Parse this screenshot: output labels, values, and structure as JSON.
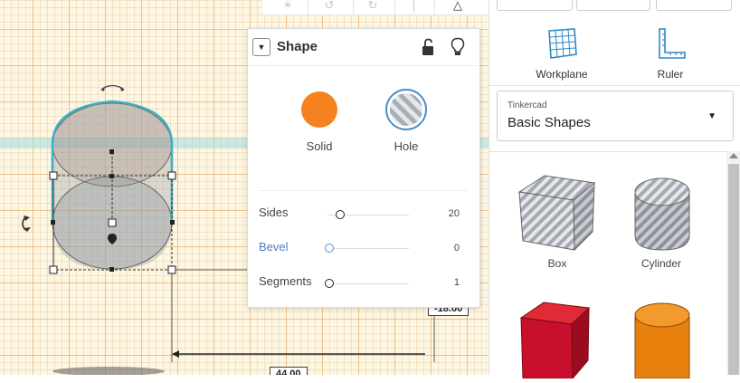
{
  "app": {
    "name": "Tinkercad"
  },
  "shape_panel": {
    "title": "Shape",
    "solid_label": "Solid",
    "hole_label": "Hole",
    "solid_color": "#f5821f",
    "hole_accent": "#4a90c8",
    "properties": [
      {
        "label": "Sides",
        "value": "20",
        "slider_fraction": 0.15
      },
      {
        "label": "Bevel",
        "value": "0",
        "slider_fraction": 0.0
      },
      {
        "label": "Segments",
        "value": "1",
        "slider_fraction": 0.0
      }
    ],
    "icons": {
      "collapse": "chevron-down-icon",
      "lock": "unlock-icon",
      "visibility": "lightbulb-icon"
    }
  },
  "dimensions": {
    "height_value": "-18.00",
    "width_value": "44.00"
  },
  "sidebar": {
    "tools": [
      {
        "label": "Workplane",
        "icon": "workplane-icon"
      },
      {
        "label": "Ruler",
        "icon": "ruler-icon"
      }
    ],
    "library": {
      "category": "Tinkercad",
      "selected": "Basic Shapes"
    },
    "shapes": [
      {
        "label": "Box",
        "style": "hole-striped"
      },
      {
        "label": "Cylinder",
        "style": "hole-striped"
      },
      {
        "label": "",
        "style": "red-box"
      },
      {
        "label": "",
        "style": "orange-cylinder"
      }
    ]
  },
  "colors": {
    "workplane": "#fdf6e3",
    "grid": "#ebaa5a",
    "selection": "#3ab0c4",
    "box_red": "#c8102e",
    "cylinder_orange": "#e8800e"
  }
}
